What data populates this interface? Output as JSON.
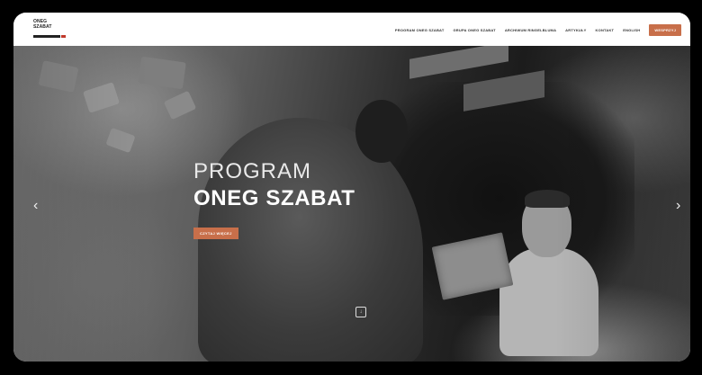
{
  "logo": {
    "lines": [
      "ONEG",
      "SZABAT"
    ]
  },
  "nav": {
    "items": [
      {
        "label": "Program Oneg Szabat"
      },
      {
        "label": "Grupa Oneg Szabat"
      },
      {
        "label": "Archiwum Ringelbluma"
      },
      {
        "label": "Artykuły"
      },
      {
        "label": "Kontakt"
      },
      {
        "label": "English"
      }
    ],
    "donate_label": "Wesprzyj"
  },
  "hero": {
    "title_line1": "PROGRAM",
    "title_line2": "ONEG SZABAT",
    "cta_label": "Czytaj więcej",
    "prev_icon": "‹",
    "next_icon": "›",
    "scroll_icon": "↓"
  },
  "colors": {
    "accent": "#c86f4a"
  }
}
